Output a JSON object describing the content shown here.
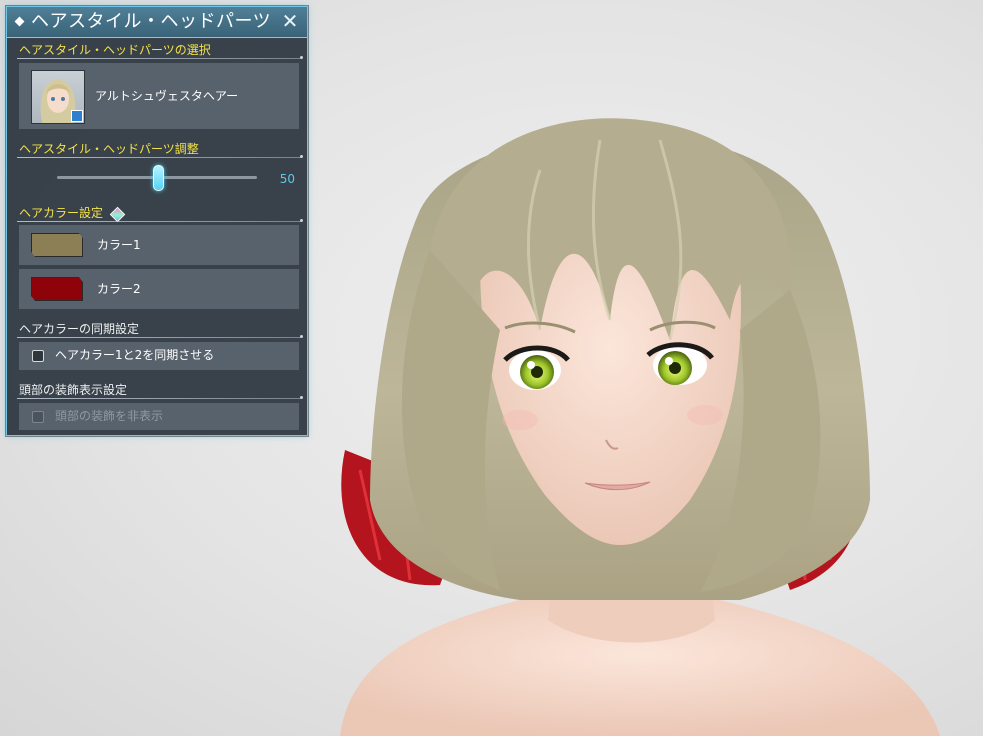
{
  "panel": {
    "title": "ヘアスタイル・ヘッドパーツ",
    "close_icon": "close-icon",
    "title_icon": "diamond-icon"
  },
  "hairstyle_select": {
    "label": "ヘアスタイル・ヘッドパーツの選択",
    "item_name": "アルトシュヴェスタヘアー"
  },
  "adjust": {
    "label": "ヘアスタイル・ヘッドパーツ調整",
    "value": 50,
    "value_text": "50",
    "max": 100
  },
  "hair_color": {
    "label": "ヘアカラー設定",
    "label_icon": "gem-icon",
    "colors": [
      {
        "label": "カラー1",
        "swatch": "#8c7f56"
      },
      {
        "label": "カラー2",
        "swatch": "#8e0209"
      }
    ]
  },
  "sync": {
    "label": "ヘアカラーの同期設定",
    "checkbox_label": "ヘアカラー1と2を同期させる",
    "checked": false
  },
  "head_accessory": {
    "label": "頭部の装飾表示設定",
    "checkbox_label": "頭部の装飾を非表示",
    "checked": false,
    "disabled": true
  },
  "theme": {
    "accent": "#6fc6e6",
    "section_label_color": "#f3e24a",
    "panel_bg": "#2e3740"
  }
}
